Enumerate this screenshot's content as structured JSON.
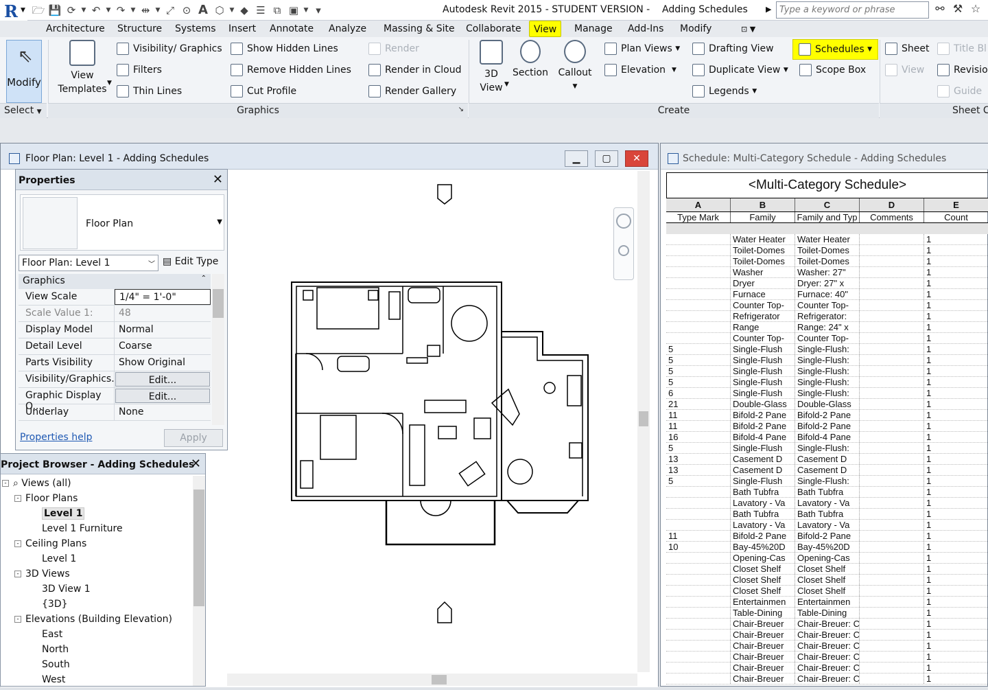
{
  "app": {
    "title": "Autodesk Revit 2015 - STUDENT VERSION -    Adding Schedules",
    "search_placeholder": "Type a keyword or phrase"
  },
  "tabs": [
    "Architecture",
    "Structure",
    "Systems",
    "Insert",
    "Annotate",
    "Analyze",
    "Massing & Site",
    "Collaborate",
    "View",
    "Manage",
    "Add-Ins",
    "Modify"
  ],
  "active_tab": "View",
  "highlight_color": "#ffff00",
  "ribbon": {
    "modify": "Modify",
    "select": "Select",
    "view_templates": [
      "View",
      "Templates"
    ],
    "visibility_graphics": "Visibility/ Graphics",
    "filters": "Filters",
    "thin_lines": "Thin  Lines",
    "show_hidden_lines": "Show  Hidden Lines",
    "remove_hidden_lines": "Remove  Hidden Lines",
    "cut_profile": "Cut  Profile",
    "render": "Render",
    "render_in_cloud": "Render  in Cloud",
    "render_gallery": "Render  Gallery",
    "graphics_panel": "Graphics",
    "view_3d": [
      "3D",
      "View"
    ],
    "section": "Section",
    "callout": "Callout",
    "plan_views": "Plan  Views",
    "elevation": "Elevation",
    "drafting_view": "Drafting  View",
    "duplicate_view": "Duplicate  View",
    "legends": "Legends",
    "schedules": "Schedules",
    "scope_box": "Scope  Box",
    "sheet": "Sheet",
    "title_bl": "Title  Bl",
    "view": "View",
    "revision": "Revision",
    "guide": "Guide",
    "create_panel": "Create",
    "sheet_comp_panel": "Sheet C"
  },
  "floor_plan": {
    "title": "Floor Plan: Level 1 - Adding Schedules"
  },
  "properties": {
    "title": "Properties",
    "type_name": "Floor Plan",
    "instance": "Floor Plan: Level 1",
    "edit_type": "Edit Type",
    "group": "Graphics",
    "rows": [
      {
        "k": "View Scale",
        "v": "1/4\" = 1'-0\""
      },
      {
        "k": "Scale Value    1:",
        "v": "48"
      },
      {
        "k": "Display Model",
        "v": "Normal"
      },
      {
        "k": "Detail Level",
        "v": "Coarse"
      },
      {
        "k": "Parts Visibility",
        "v": "Show Original"
      },
      {
        "k": "Visibility/Graphics...",
        "v": "Edit..."
      },
      {
        "k": "Graphic Display O...",
        "v": "Edit..."
      },
      {
        "k": "Underlay",
        "v": "None"
      }
    ],
    "help": "Properties help",
    "apply": "Apply"
  },
  "browser": {
    "title": "Project Browser - Adding Schedules",
    "nodes": [
      {
        "label": "Views (all)",
        "level": 0,
        "toggle": "-"
      },
      {
        "label": "Floor Plans",
        "level": 1,
        "toggle": "-"
      },
      {
        "label": "Level 1",
        "level": 2,
        "selected": true
      },
      {
        "label": "Level 1 Furniture",
        "level": 2
      },
      {
        "label": "Ceiling Plans",
        "level": 1,
        "toggle": "-"
      },
      {
        "label": "Level 1",
        "level": 2
      },
      {
        "label": "3D Views",
        "level": 1,
        "toggle": "-"
      },
      {
        "label": "3D View 1",
        "level": 2
      },
      {
        "label": "{3D}",
        "level": 2
      },
      {
        "label": "Elevations (Building Elevation)",
        "level": 1,
        "toggle": "-"
      },
      {
        "label": "East",
        "level": 2
      },
      {
        "label": "North",
        "level": 2
      },
      {
        "label": "South",
        "level": 2
      },
      {
        "label": "West",
        "level": 2
      }
    ]
  },
  "schedule": {
    "window_title": "Schedule: Multi-Category Schedule - Adding Schedules",
    "title": "<Multi-Category Schedule>",
    "columns": [
      "A",
      "B",
      "C",
      "D",
      "E"
    ],
    "fields": [
      "Type Mark",
      "Family",
      "Family and Typ",
      "Comments",
      "Count"
    ],
    "rows": [
      [
        "",
        "Water Heater",
        "Water Heater",
        "",
        "1"
      ],
      [
        "",
        "Toilet-Domes",
        "Toilet-Domes",
        "",
        "1"
      ],
      [
        "",
        "Toilet-Domes",
        "Toilet-Domes",
        "",
        "1"
      ],
      [
        "",
        "Washer",
        "Washer: 27\"",
        "",
        "1"
      ],
      [
        "",
        "Dryer",
        "Dryer: 27\" x",
        "",
        "1"
      ],
      [
        "",
        "Furnace",
        "Furnace: 40\"",
        "",
        "1"
      ],
      [
        "",
        "Counter Top-",
        "Counter Top-",
        "",
        "1"
      ],
      [
        "",
        "Refrigerator",
        "Refrigerator:",
        "",
        "1"
      ],
      [
        "",
        "Range",
        "Range: 24\" x",
        "",
        "1"
      ],
      [
        "",
        "Counter Top-",
        "Counter Top-",
        "",
        "1"
      ],
      [
        "5",
        "Single-Flush",
        "Single-Flush:",
        "",
        "1"
      ],
      [
        "5",
        "Single-Flush",
        "Single-Flush:",
        "",
        "1"
      ],
      [
        "5",
        "Single-Flush",
        "Single-Flush:",
        "",
        "1"
      ],
      [
        "5",
        "Single-Flush",
        "Single-Flush:",
        "",
        "1"
      ],
      [
        "6",
        "Single-Flush",
        "Single-Flush:",
        "",
        "1"
      ],
      [
        "21",
        "Double-Glass",
        "Double-Glass",
        "",
        "1"
      ],
      [
        "11",
        "Bifold-2 Pane",
        "Bifold-2 Pane",
        "",
        "1"
      ],
      [
        "11",
        "Bifold-2 Pane",
        "Bifold-2 Pane",
        "",
        "1"
      ],
      [
        "16",
        "Bifold-4 Pane",
        "Bifold-4 Pane",
        "",
        "1"
      ],
      [
        "5",
        "Single-Flush",
        "Single-Flush:",
        "",
        "1"
      ],
      [
        "13",
        "Casement D",
        "Casement D",
        "",
        "1"
      ],
      [
        "13",
        "Casement D",
        "Casement D",
        "",
        "1"
      ],
      [
        "5",
        "Single-Flush",
        "Single-Flush:",
        "",
        "1"
      ],
      [
        "",
        "Bath  Tubfra",
        "Bath  Tubfra",
        "",
        "1"
      ],
      [
        "",
        "Lavatory - Va",
        "Lavatory - Va",
        "",
        "1"
      ],
      [
        "",
        "Bath  Tubfra",
        "Bath  Tubfra",
        "",
        "1"
      ],
      [
        "",
        "Lavatory - Va",
        "Lavatory - Va",
        "",
        "1"
      ],
      [
        "11",
        "Bifold-2 Pane",
        "Bifold-2 Pane",
        "",
        "1"
      ],
      [
        "10",
        "Bay-45%20D",
        "Bay-45%20D",
        "",
        "1"
      ],
      [
        "",
        "Opening-Cas",
        "Opening-Cas",
        "",
        "1"
      ],
      [
        "",
        "Closet Shelf",
        "Closet Shelf",
        "",
        "1"
      ],
      [
        "",
        "Closet Shelf",
        "Closet Shelf",
        "",
        "1"
      ],
      [
        "",
        "Closet Shelf",
        "Closet Shelf",
        "",
        "1"
      ],
      [
        "",
        "Entertainmen",
        "Entertainmen",
        "",
        "1"
      ],
      [
        "",
        "Table-Dining",
        "Table-Dining",
        "",
        "1"
      ],
      [
        "",
        "Chair-Breuer",
        "Chair-Breuer: C",
        "",
        "1"
      ],
      [
        "",
        "Chair-Breuer",
        "Chair-Breuer: C",
        "",
        "1"
      ],
      [
        "",
        "Chair-Breuer",
        "Chair-Breuer: C",
        "",
        "1"
      ],
      [
        "",
        "Chair-Breuer",
        "Chair-Breuer: C",
        "",
        "1"
      ],
      [
        "",
        "Chair-Breuer",
        "Chair-Breuer: C",
        "",
        "1"
      ],
      [
        "",
        "Chair-Breuer",
        "Chair-Breuer: C",
        "",
        "1"
      ]
    ]
  }
}
